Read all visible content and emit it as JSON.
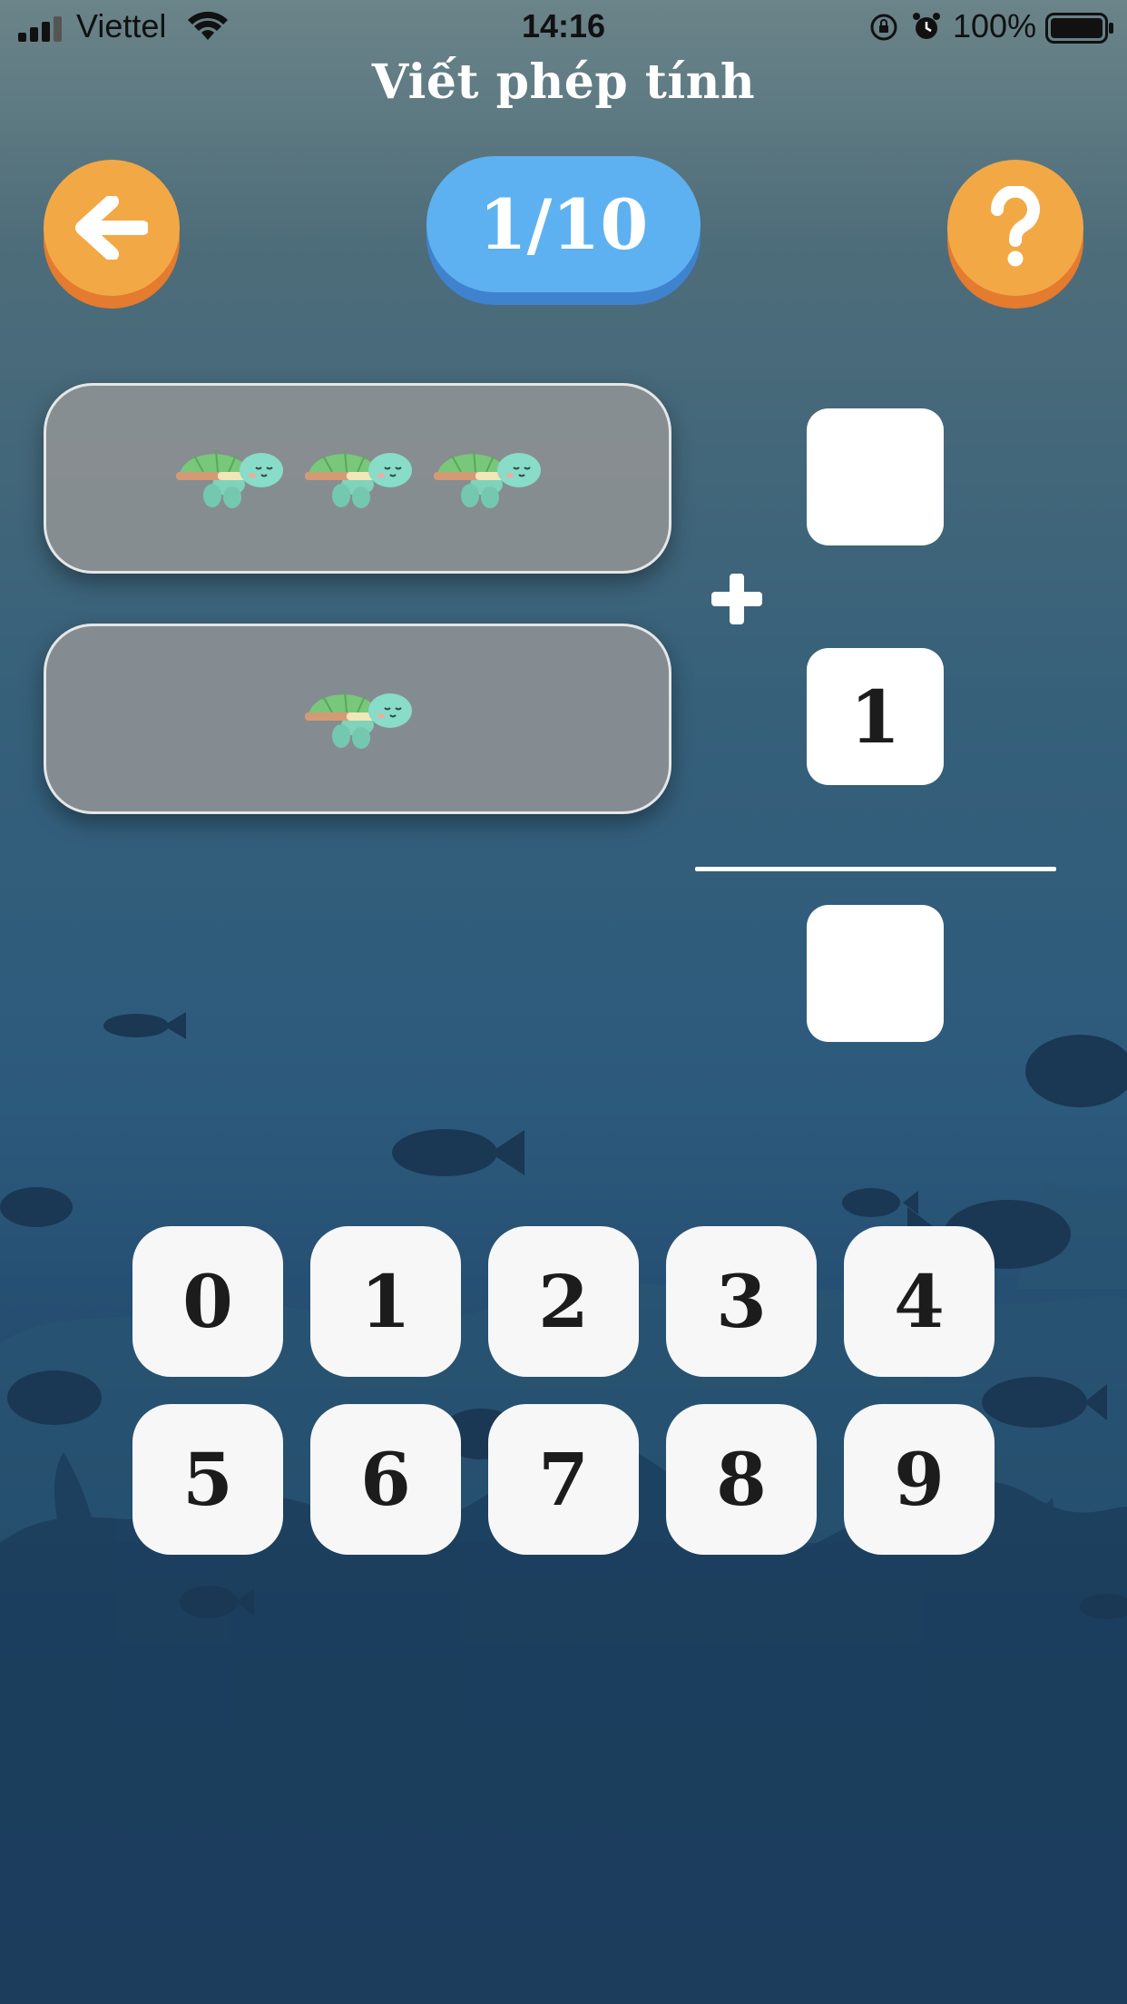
{
  "status_bar": {
    "carrier": "Viettel",
    "time": "14:16",
    "battery": "100%"
  },
  "header": {
    "title": "Viết phép tính",
    "progress": "1/10",
    "back_icon": "arrow-left-icon",
    "help_icon": "question-mark-icon"
  },
  "problem": {
    "top_group": {
      "turtle_count": 3
    },
    "bottom_group": {
      "turtle_count": 1
    },
    "operator": "plus",
    "first_answer": "",
    "second_operand": "1",
    "result_answer": ""
  },
  "keypad": {
    "keys": [
      "0",
      "1",
      "2",
      "3",
      "4",
      "5",
      "6",
      "7",
      "8",
      "9"
    ]
  },
  "colors": {
    "button_orange": "#f3a846",
    "progress_blue": "#5eb1f0"
  }
}
